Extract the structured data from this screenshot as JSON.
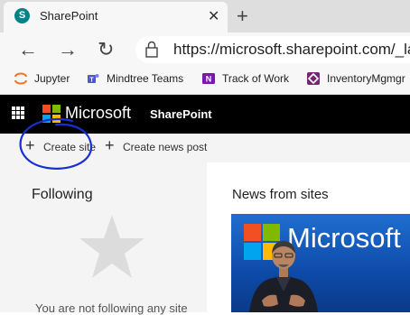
{
  "browser": {
    "tab": {
      "title": "SharePoint",
      "close_glyph": "✕",
      "icon": "sharepoint-icon"
    },
    "new_tab_glyph": "+",
    "nav": {
      "back_glyph": "←",
      "forward_glyph": "→",
      "refresh_glyph": "↻"
    },
    "address": {
      "url": "https://microsoft.sharepoint.com/_la",
      "icon": "lock-icon"
    },
    "favorites": [
      {
        "label": "Jupyter",
        "icon": "jupyter-icon",
        "color": "#f37626"
      },
      {
        "label": "Mindtree Teams",
        "icon": "teams-icon",
        "color": "#5059c9"
      },
      {
        "label": "Track of Work",
        "icon": "onenote-icon",
        "color": "#7719aa"
      },
      {
        "label": "InventoryMgmgr",
        "icon": "powerapps-icon",
        "color": "#742774"
      }
    ]
  },
  "suitebar": {
    "brand": "Microsoft",
    "app": "SharePoint",
    "logo_colors": [
      "#f25022",
      "#7fba00",
      "#00a4ef",
      "#ffb900"
    ]
  },
  "commands": {
    "create_site": "Create site",
    "create_news": "Create news post"
  },
  "following": {
    "title": "Following",
    "empty_message": "You are not following any site"
  },
  "news": {
    "title": "News from sites",
    "image_brand": "Microsoft"
  },
  "annotation": {
    "color": "#1a2fd0"
  }
}
